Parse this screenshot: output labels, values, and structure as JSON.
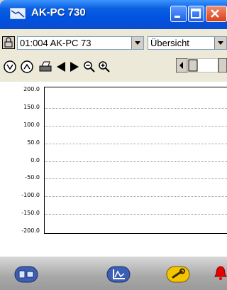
{
  "window": {
    "title": "AK-PC 730"
  },
  "toolbar": {
    "device_select": "01:004 AK-PC 73",
    "view_select": "Übersicht"
  },
  "icons": {
    "app": "refrigeration-controller-icon",
    "lock": "lock-icon",
    "refresh_all": "refresh-all-icon",
    "refresh": "refresh-icon",
    "print": "printer-icon",
    "prev": "scroll-left-icon",
    "next": "scroll-right-icon",
    "zoom_out": "zoom-out-icon",
    "zoom_in": "zoom-in-icon",
    "bottom_left": "controller-icon",
    "bottom_middle": "chart-icon",
    "bottom_right": "service-wrench-icon",
    "bottom_alarm": "alarm-bell-icon"
  },
  "colors": {
    "title_blue": "#0053e1",
    "close_red": "#d8411c",
    "wrench_yellow": "#f5c400",
    "alarm_red": "#e60000"
  },
  "chart_data": {
    "type": "line",
    "series": [],
    "y_ticks": [
      "200.0",
      "150.0",
      "100.0",
      "50.0",
      "0.0",
      "-50.0",
      "-100.0",
      "-150.0",
      "-200.0"
    ],
    "ylim": [
      -200,
      200
    ],
    "grid": true
  }
}
